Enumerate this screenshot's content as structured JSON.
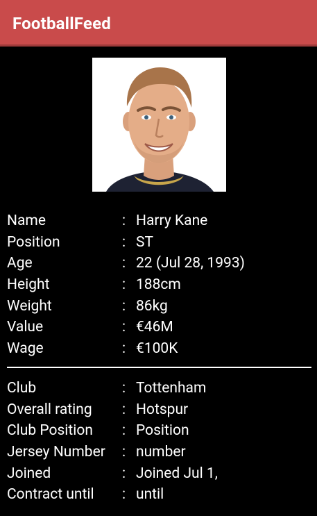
{
  "app_bar": {
    "title": "FootballFeed",
    "color": "#c94b4b"
  },
  "player_photo": {
    "icon": "player-portrait"
  },
  "personal_info": [
    {
      "label": "Name",
      "value": "Harry Kane"
    },
    {
      "label": "Position",
      "value": "ST"
    },
    {
      "label": "Age",
      "value": "22 (Jul 28, 1993)"
    },
    {
      "label": "Height",
      "value": "188cm"
    },
    {
      "label": "Weight",
      "value": "86kg"
    },
    {
      "label": "Value",
      "value": "€46M"
    },
    {
      "label": "Wage",
      "value": "€100K"
    }
  ],
  "club_info": [
    {
      "label": "Club",
      "value": "Tottenham"
    },
    {
      "label": "Overall rating",
      "value": "Hotspur"
    },
    {
      "label": "Club Position",
      "value": "Position"
    },
    {
      "label": "Jersey Number",
      "value": "number"
    },
    {
      "label": "Joined",
      "value": "Joined Jul 1,"
    },
    {
      "label": "Contract until",
      "value": "until"
    }
  ],
  "separator": ":"
}
